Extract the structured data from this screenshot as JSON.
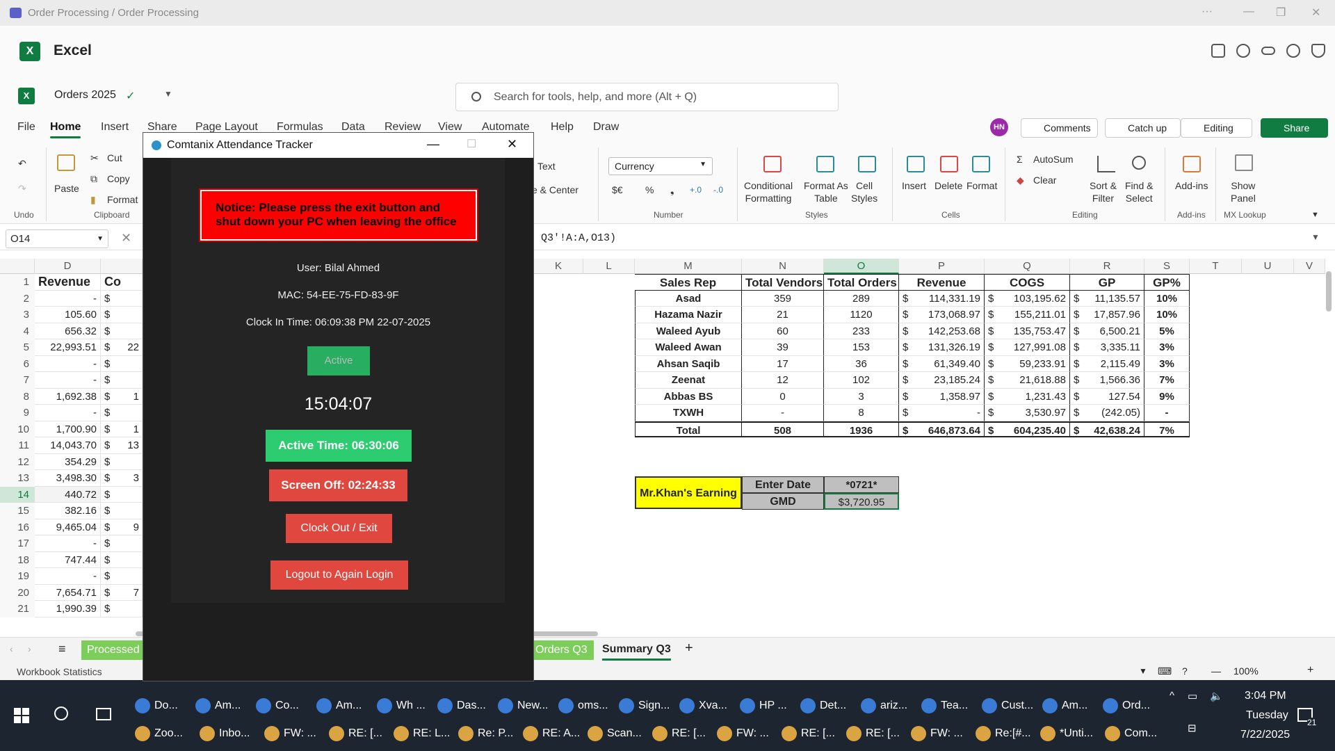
{
  "window": {
    "title": "Order Processing / Order Processing"
  },
  "app": {
    "name": "Excel"
  },
  "doc": {
    "name": "Orders 2025"
  },
  "search": {
    "placeholder": "Search for tools, help, and more (Alt + Q)"
  },
  "tabs": [
    "File",
    "Home",
    "Insert",
    "Share",
    "Page Layout",
    "Formulas",
    "Data",
    "Review",
    "View",
    "Automate",
    "Help",
    "Draw"
  ],
  "header_buttons": {
    "avatar": "HN",
    "comments": "Comments",
    "catchup": "Catch up",
    "editing": "Editing",
    "share": "Share"
  },
  "ribbon": {
    "undo_group": "Undo",
    "paste": "Paste",
    "cut": "Cut",
    "copy": "Copy",
    "format_painter": "Format",
    "clipboard": "Clipboard",
    "wrap_text": "Text",
    "merge": "e & Center",
    "number_format": "Currency",
    "number_symbols": [
      "$€",
      "%",
      "❟",
      "+.0",
      "-.0"
    ],
    "number": "Number",
    "conditional": "Conditional\nFormatting",
    "format_table": "Format As\nTable",
    "cell_styles": "Cell\nStyles",
    "styles": "Styles",
    "insert": "Insert",
    "delete": "Delete",
    "format": "Format",
    "cells": "Cells",
    "autosum": "AutoSum",
    "clear": "Clear",
    "sort": "Sort &\nFilter",
    "find": "Find &\nSelect",
    "editing": "Editing",
    "addins": "Add-ins",
    "addins_group": "Add-ins",
    "show_panel": "Show\nPanel",
    "mx_lookup": "MX Lookup"
  },
  "formula": {
    "namebox": "O14",
    "text": "Q3'!A:A,O13)"
  },
  "columns": [
    "D",
    "K",
    "L",
    "M",
    "N",
    "O",
    "P",
    "Q",
    "R",
    "S",
    "T",
    "U",
    "V"
  ],
  "left_column": {
    "header": "Revenue",
    "header2": "Co",
    "values": [
      "-",
      "105.60",
      "656.32",
      "22,993.51",
      "-",
      "-",
      "1,692.38",
      "-",
      "1,700.90",
      "14,043.70",
      "354.29",
      "3,498.30",
      "440.72",
      "382.16",
      "9,465.04",
      "-",
      "747.44",
      "-",
      "7,654.71",
      "1,990.39"
    ],
    "partial": [
      "",
      "",
      "",
      "22",
      "",
      "",
      "1",
      "",
      "1",
      "13",
      "",
      "3",
      "",
      "",
      "9",
      "",
      "",
      "",
      "7",
      ""
    ]
  },
  "rows": [
    "1",
    "2",
    "3",
    "4",
    "5",
    "6",
    "7",
    "8",
    "9",
    "10",
    "11",
    "12",
    "13",
    "14",
    "15",
    "16",
    "17",
    "18",
    "19",
    "20",
    "21"
  ],
  "table": {
    "headers": [
      "Sales Rep",
      "Total Vendors",
      "Total Orders",
      "Revenue",
      "COGS",
      "GP",
      "GP%"
    ],
    "rows": [
      [
        "Asad",
        "359",
        "289",
        "114,331.19",
        "103,195.62",
        "11,135.57",
        "10%"
      ],
      [
        "Hazama Nazir",
        "21",
        "1120",
        "173,068.97",
        "155,211.01",
        "17,857.96",
        "10%"
      ],
      [
        "Waleed Ayub",
        "60",
        "233",
        "142,253.68",
        "135,753.47",
        "6,500.21",
        "5%"
      ],
      [
        "Waleed Awan",
        "39",
        "153",
        "131,326.19",
        "127,991.08",
        "3,335.11",
        "3%"
      ],
      [
        "Ahsan Saqib",
        "17",
        "36",
        "61,349.40",
        "59,233.91",
        "2,115.49",
        "3%"
      ],
      [
        "Zeenat",
        "12",
        "102",
        "23,185.24",
        "21,618.88",
        "1,566.36",
        "7%"
      ],
      [
        "Abbas BS",
        "0",
        "3",
        "1,358.97",
        "1,231.43",
        "127.54",
        "9%"
      ],
      [
        "TXWH",
        "-",
        "8",
        "-",
        "3,530.97",
        "(242.05)",
        "-"
      ],
      [
        "Total",
        "508",
        "1936",
        "646,873.64",
        "604,235.40",
        "42,638.24",
        "7%"
      ]
    ],
    "currency": "$"
  },
  "earning": {
    "label": "Mr.Khan's Earning",
    "enter_date": "Enter Date",
    "date_value": "*0721*",
    "gmd": "GMD",
    "gmd_value": "$3,720.95"
  },
  "popup": {
    "title": "Comtanix Attendance Tracker",
    "notice": "Notice: Please press the exit button and shut down your PC when leaving the office",
    "user": "User: Bilal Ahmed",
    "mac": "MAC: 54-EE-75-FD-83-9F",
    "clock_in": "Clock In Time: 06:09:38 PM 22-07-2025",
    "status": "Active",
    "clock": "15:04:07",
    "active_time": "Active Time: 06:30:06",
    "screen_off": "Screen Off: 02:24:33",
    "clock_out": "Clock Out / Exit",
    "logout": "Logout to Again Login"
  },
  "sheets": {
    "processed": "Processed",
    "orders": "Orders Q3",
    "summary": "Summary Q3",
    "add": "+"
  },
  "statusbar": {
    "left": "Workbook Statistics",
    "zoom": "100%"
  },
  "taskbar": {
    "row1": [
      "Do...",
      "Am...",
      "Co...",
      "Am...",
      "Wh ...",
      "Das...",
      "New...",
      "oms...",
      "Sign...",
      "Xva...",
      "HP ...",
      "Det...",
      "ariz...",
      "Tea...",
      "Cust...",
      "Am...",
      "Ord..."
    ],
    "row2": [
      "Zoo...",
      "Inbo...",
      "FW: ...",
      "RE: [...",
      "RE: L...",
      "Re: P...",
      "RE: A...",
      "Scan...",
      "RE: [...",
      "FW: ...",
      "RE: [...",
      "RE: [...",
      "FW: ...",
      "Re:[#...",
      "*Unti...",
      "Com..."
    ],
    "time": "3:04 PM",
    "day": "Tuesday",
    "date": "7/22/2025",
    "notif": "21"
  },
  "colors": {
    "excel_green": "#107c41",
    "notice_red": "#ff0000",
    "btn_red": "#e0473e",
    "btn_green": "#2ecc71",
    "active_green": "#27ae60",
    "yellow": "#ffff00"
  }
}
